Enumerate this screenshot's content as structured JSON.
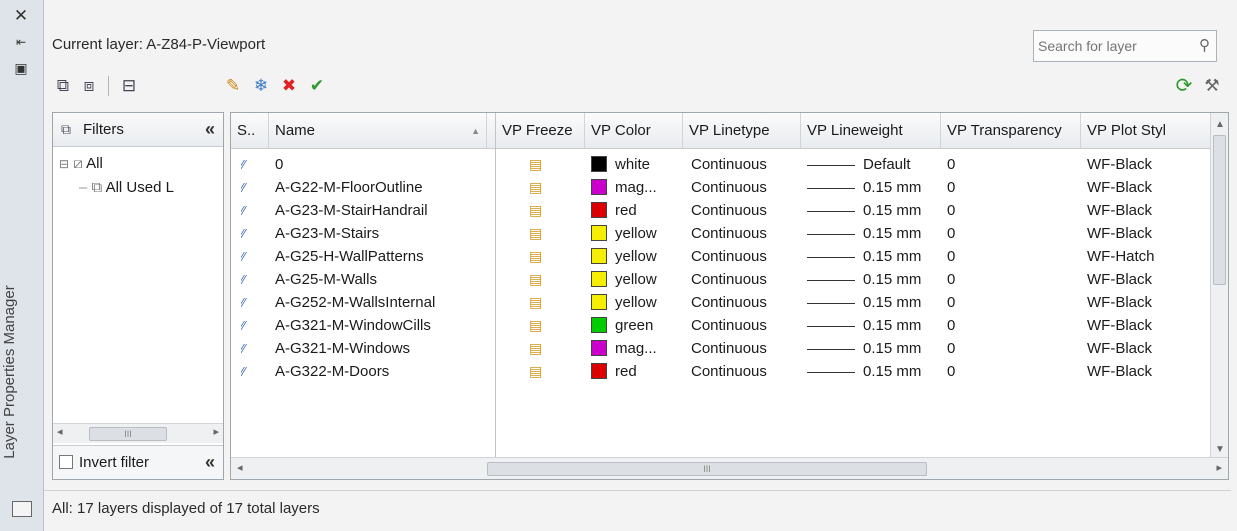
{
  "palette": {
    "title": "Layer Properties Manager",
    "icons": [
      "close-icon",
      "autohide-icon",
      "properties-icon"
    ]
  },
  "header": {
    "current_layer": "Current layer: A-Z84-P-Viewport",
    "search_placeholder": "Search for layer"
  },
  "toolbar": {
    "left_icons": [
      "new-property-filter-icon",
      "new-group-filter-icon",
      "layer-states-manager-icon"
    ],
    "layer_icons": [
      "new-layer-icon",
      "new-layer-vp-frozen-icon",
      "delete-layer-icon",
      "set-current-icon"
    ],
    "right_icons": [
      "refresh-icon",
      "settings-icon"
    ]
  },
  "filters": {
    "header": "Filters",
    "tree": [
      {
        "label": "All",
        "level": 0
      },
      {
        "label": "All Used L",
        "level": 1
      }
    ],
    "invert_label": "Invert filter",
    "scroll_label": "III"
  },
  "grid": {
    "columns": [
      "S..",
      "Name",
      "VP Freeze",
      "VP Color",
      "VP Linetype",
      "VP Lineweight",
      "VP Transparency",
      "VP Plot Styl"
    ],
    "rows": [
      {
        "name": "0",
        "color": "white",
        "swatch": "#000000",
        "linetype": "Continuous",
        "lineweight": "Default",
        "transparency": "0",
        "plot_style": "WF-Black"
      },
      {
        "name": "A-G22-M-FloorOutline",
        "color": "mag...",
        "swatch": "#cc00cc",
        "linetype": "Continuous",
        "lineweight": "0.15 mm",
        "transparency": "0",
        "plot_style": "WF-Black"
      },
      {
        "name": "A-G23-M-StairHandrail",
        "color": "red",
        "swatch": "#dd0000",
        "linetype": "Continuous",
        "lineweight": "0.15 mm",
        "transparency": "0",
        "plot_style": "WF-Black"
      },
      {
        "name": "A-G23-M-Stairs",
        "color": "yellow",
        "swatch": "#f5ee00",
        "linetype": "Continuous",
        "lineweight": "0.15 mm",
        "transparency": "0",
        "plot_style": "WF-Black"
      },
      {
        "name": "A-G25-H-WallPatterns",
        "color": "yellow",
        "swatch": "#f5ee00",
        "linetype": "Continuous",
        "lineweight": "0.15 mm",
        "transparency": "0",
        "plot_style": "WF-Hatch"
      },
      {
        "name": "A-G25-M-Walls",
        "color": "yellow",
        "swatch": "#f5ee00",
        "linetype": "Continuous",
        "lineweight": "0.15 mm",
        "transparency": "0",
        "plot_style": "WF-Black"
      },
      {
        "name": "A-G252-M-WallsInternal",
        "color": "yellow",
        "swatch": "#f5ee00",
        "linetype": "Continuous",
        "lineweight": "0.15 mm",
        "transparency": "0",
        "plot_style": "WF-Black"
      },
      {
        "name": "A-G321-M-WindowCills",
        "color": "green",
        "swatch": "#00cc00",
        "linetype": "Continuous",
        "lineweight": "0.15 mm",
        "transparency": "0",
        "plot_style": "WF-Black"
      },
      {
        "name": "A-G321-M-Windows",
        "color": "mag...",
        "swatch": "#cc00cc",
        "linetype": "Continuous",
        "lineweight": "0.15 mm",
        "transparency": "0",
        "plot_style": "WF-Black"
      },
      {
        "name": "A-G322-M-Doors",
        "color": "red",
        "swatch": "#dd0000",
        "linetype": "Continuous",
        "lineweight": "0.15 mm",
        "transparency": "0",
        "plot_style": "WF-Black"
      }
    ],
    "hscroll_label": "III"
  },
  "status": {
    "text": "All: 17 layers displayed of 17 total layers"
  }
}
